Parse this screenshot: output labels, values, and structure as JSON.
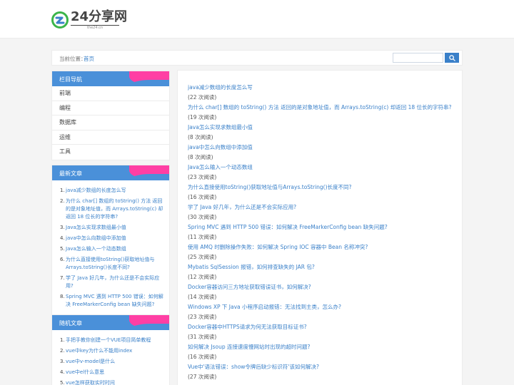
{
  "header": {
    "logo_text": "24分享网",
    "logo_sub": "the24.cn"
  },
  "breadcrumb": {
    "label": "当前位置：",
    "home": "首页"
  },
  "search": {
    "placeholder": ""
  },
  "nav": {
    "title": "栏目导航",
    "items": [
      "前端",
      "编程",
      "数据库",
      "运维",
      "工具"
    ]
  },
  "latest": {
    "title": "最新文章",
    "items": [
      "java减少数组的长度怎么写",
      "为什么 char[] 数组的 toString() 方法 返回的是对象地址值，而 Arrays.toString(c) 却返回 18 位长的字符串?",
      "Java怎么实现求数组最小值",
      "java中怎么向数组中添加值",
      "Java怎么输入一个动态数组",
      "为什么直接使用toString()获取地址值与Arrays.toString()长度不同?",
      "学了 Java 好几年，为什么还是不会实际应用?",
      "Spring MVC 遇到 HTTP 500 错误：如何解决 FreeMarkerConfig bean 缺失问题?"
    ]
  },
  "random": {
    "title": "随机文章",
    "items": [
      "手把手教你创建一个VUE项目简单教程",
      "vue中key为什么不能用index",
      "vue中v-model是什么",
      "vue中el什么意思",
      "vue怎样获取实时时间"
    ]
  },
  "articles": [
    {
      "title": "java减少数组的长度怎么写",
      "views": "(22 次阅读)"
    },
    {
      "title": "为什么 char[] 数组的 toString() 方法 返回的是对象地址值，而 Arrays.toString(c) 却返回 18 位长的字符串?",
      "views": "(19 次阅读)"
    },
    {
      "title": "Java怎么实现求数组最小值",
      "views": "(8 次阅读)"
    },
    {
      "title": "java中怎么向数组中添加值",
      "views": "(8 次阅读)"
    },
    {
      "title": "Java怎么输入一个动态数组",
      "views": "(23 次阅读)"
    },
    {
      "title": "为什么直接使用toString()获取地址值与Arrays.toString()长度不同?",
      "views": "(16 次阅读)"
    },
    {
      "title": "学了 Java 好几年，为什么还是不会实际应用?",
      "views": "(30 次阅读)"
    },
    {
      "title": "Spring MVC 遇到 HTTP 500 错误：如何解决 FreeMarkerConfig bean 缺失问题?",
      "views": "(11 次阅读)"
    },
    {
      "title": "使用 AMQ 时删除操作失败：如何解决 Spring IOC 容器中 Bean 名称冲突?",
      "views": "(25 次阅读)"
    },
    {
      "title": "Mybatis SqlSession 报错，如何排查缺失的 JAR 包?",
      "views": "(12 次阅读)"
    },
    {
      "title": "Docker容器访问三方地址获取错误证书，如何解决?",
      "views": "(14 次阅读)"
    },
    {
      "title": "Windows XP 下 Java 小程序启动报错：无法找到主类，怎么办?",
      "views": "(23 次阅读)"
    },
    {
      "title": "Docker容器中HTTPS请求为何无法获取目标证书?",
      "views": "(31 次阅读)"
    },
    {
      "title": "如何解决 Jsoup 连接速度慢网站时出现的超时问题?",
      "views": "(16 次阅读)"
    },
    {
      "title": "Vue中'语法错误：show令牌后缺少标识符'该如何解决?",
      "views": "(27 次阅读)"
    }
  ],
  "colors": {
    "accent": "#3a80c9",
    "panel_head": "#4a90d9",
    "panel_pink": "#ff3fa4"
  }
}
